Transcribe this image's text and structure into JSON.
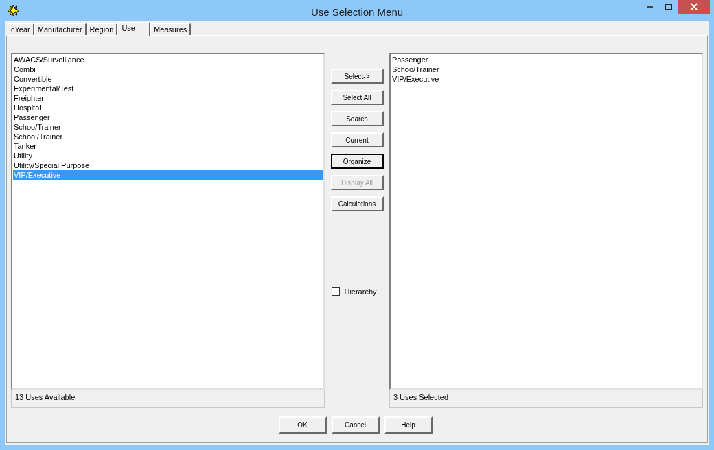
{
  "window": {
    "title": "Use Selection Menu"
  },
  "tabs": [
    {
      "label": "cYear",
      "selected": false
    },
    {
      "label": "Manufacturer",
      "selected": false
    },
    {
      "label": "Region",
      "selected": false
    },
    {
      "label": "Use",
      "selected": true
    },
    {
      "label": "Measures",
      "selected": false
    }
  ],
  "available": {
    "items": [
      {
        "label": "AWACS/Surveillance",
        "selected": false
      },
      {
        "label": "Combi",
        "selected": false
      },
      {
        "label": "Convertible",
        "selected": false
      },
      {
        "label": "Experimental/Test",
        "selected": false
      },
      {
        "label": "Freighter",
        "selected": false
      },
      {
        "label": "Hospital",
        "selected": false
      },
      {
        "label": "Passenger",
        "selected": false
      },
      {
        "label": "Schoo/Trainer",
        "selected": false
      },
      {
        "label": "School/Trainer",
        "selected": false
      },
      {
        "label": "Tanker",
        "selected": false
      },
      {
        "label": "Utility",
        "selected": false
      },
      {
        "label": "Utility/Special Purpose",
        "selected": false
      },
      {
        "label": "VIP/Executive",
        "selected": true
      }
    ],
    "status": "13 Uses Available"
  },
  "actions": [
    {
      "label": "Select->",
      "focused": false,
      "disabled": false
    },
    {
      "label": "Select All",
      "focused": false,
      "disabled": false
    },
    {
      "label": "Search",
      "focused": false,
      "disabled": false
    },
    {
      "label": "Current",
      "focused": false,
      "disabled": false
    },
    {
      "label": "Organize",
      "focused": true,
      "disabled": false
    },
    {
      "label": "Display All",
      "focused": false,
      "disabled": true
    },
    {
      "label": "Calculations",
      "focused": false,
      "disabled": false
    }
  ],
  "hierarchy": {
    "label": "Hierarchy",
    "checked": false
  },
  "selected_list": {
    "items": [
      {
        "label": "Passenger",
        "selected": false
      },
      {
        "label": "Schoo/Trainer",
        "selected": false
      },
      {
        "label": "VIP/Executive",
        "selected": false
      }
    ],
    "status": "3 Uses Selected"
  },
  "dialog_buttons": [
    {
      "label": "OK"
    },
    {
      "label": "Cancel"
    },
    {
      "label": "Help"
    }
  ]
}
